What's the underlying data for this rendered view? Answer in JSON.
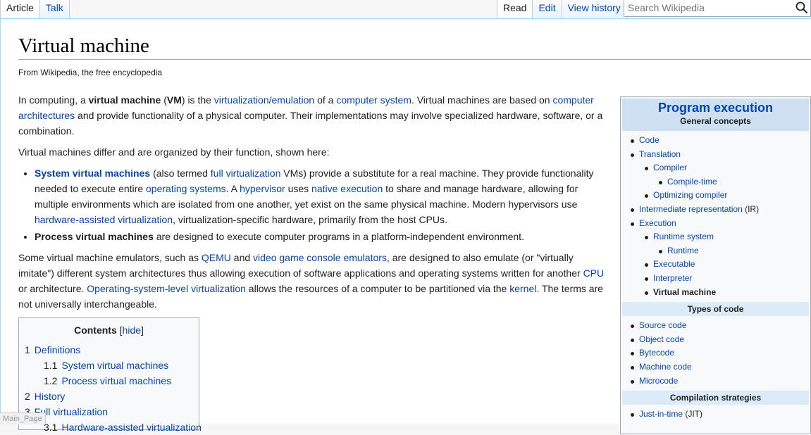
{
  "tabs_left": [
    {
      "label": "Article",
      "selected": true
    },
    {
      "label": "Talk",
      "selected": false
    }
  ],
  "tabs_right": [
    {
      "label": "Read",
      "selected": true
    },
    {
      "label": "Edit",
      "selected": false
    },
    {
      "label": "View history",
      "selected": false
    }
  ],
  "search": {
    "placeholder": "Search Wikipedia",
    "value": ""
  },
  "article": {
    "title": "Virtual machine",
    "tagline": "From Wikipedia, the free encyclopedia",
    "intro": {
      "t1": "In computing, a ",
      "b1": "virtual machine",
      "t2": " (",
      "b2": "VM",
      "t3": ") is the ",
      "l1": "virtualization/emulation",
      "t4": " of a ",
      "l2": "computer system",
      "t5": ". Virtual machines are based on ",
      "l3": "computer architectures",
      "t6": " and provide functionality of a physical computer. Their implementations may involve specialized hardware, software, or a combination."
    },
    "para2": "Virtual machines differ and are organized by their function, shown here:",
    "bullet1": {
      "l1": "System virtual machines",
      "t1": " (also termed ",
      "l2": "full virtualization",
      "t2": " VMs) provide a substitute for a real machine. They provide functionality needed to execute entire ",
      "l3": "operating systems",
      "t3": ". A ",
      "l4": "hypervisor",
      "t4": " uses ",
      "l5": "native execution",
      "t5": " to share and manage hardware, allowing for multiple environments which are isolated from one another, yet exist on the same physical machine. Modern hypervisors use ",
      "l6": "hardware-assisted virtualization",
      "t6": ", virtualization-specific hardware, primarily from the host CPUs."
    },
    "bullet2": {
      "b1": "Process virtual machines",
      "t1": " are designed to execute computer programs in a platform-independent environment."
    },
    "para3": {
      "t1": "Some virtual machine emulators, such as ",
      "l1": "QEMU",
      "t2": " and ",
      "l2": "video game console emulators",
      "t3": ", are designed to also emulate (or \"virtually imitate\") different system architectures thus allowing execution of software applications and operating systems written for another ",
      "l3": "CPU",
      "t4": " or architecture. ",
      "l4": "Operating-system-level virtualization",
      "t5": " allows the resources of a computer to be partitioned via the ",
      "l5": "kernel",
      "t6": ". The terms are not universally interchangeable."
    }
  },
  "toc": {
    "heading": "Contents",
    "hide_open": "[",
    "hide_label": "hide",
    "hide_close": "]",
    "items": [
      {
        "num": "1",
        "label": "Definitions"
      },
      {
        "num": "1.1",
        "label": "System virtual machines"
      },
      {
        "num": "1.2",
        "label": "Process virtual machines"
      },
      {
        "num": "2",
        "label": "History"
      },
      {
        "num": "3",
        "label": "Full virtualization"
      },
      {
        "num": "3.1",
        "label": "Hardware-assisted virtualization"
      }
    ]
  },
  "infobox": {
    "title": "Program execution",
    "sections": [
      {
        "heading": "General concepts",
        "items": [
          {
            "label": "Code"
          },
          {
            "label": "Translation"
          },
          {
            "label": "Compiler"
          },
          {
            "label": "Compile-time"
          },
          {
            "label": "Optimizing compiler"
          },
          {
            "label": "Intermediate representation",
            "suffix": " (IR)"
          },
          {
            "label": "Execution"
          },
          {
            "label": "Runtime system"
          },
          {
            "label": "Runtime"
          },
          {
            "label": "Executable"
          },
          {
            "label": "Interpreter"
          },
          {
            "label": "Virtual machine"
          }
        ]
      },
      {
        "heading": "Types of code",
        "items": [
          {
            "label": "Source code"
          },
          {
            "label": "Object code"
          },
          {
            "label": "Bytecode"
          },
          {
            "label": "Machine code"
          },
          {
            "label": "Microcode"
          }
        ]
      },
      {
        "heading": "Compilation strategies",
        "items": [
          {
            "label": "Just-in-time",
            "suffix": " (JIT)"
          }
        ]
      }
    ]
  },
  "status_link": "Main_Page"
}
